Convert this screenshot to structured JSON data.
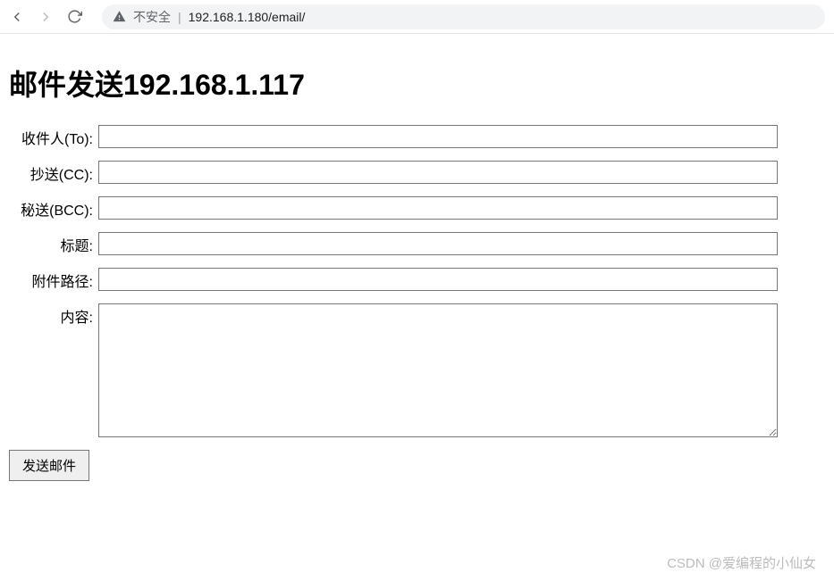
{
  "browser": {
    "security_label": "不安全",
    "url": "192.168.1.180/email/"
  },
  "page": {
    "title": "邮件发送192.168.1.117"
  },
  "form": {
    "to_label": "收件人(To):",
    "to_value": "",
    "cc_label": "抄送(CC):",
    "cc_value": "",
    "bcc_label": "秘送(BCC):",
    "bcc_value": "",
    "subject_label": "标题:",
    "subject_value": "",
    "attachment_label": "附件路径:",
    "attachment_value": "",
    "content_label": "内容:",
    "content_value": "",
    "submit_label": "发送邮件"
  },
  "watermark": "CSDN @爱编程的小仙女"
}
